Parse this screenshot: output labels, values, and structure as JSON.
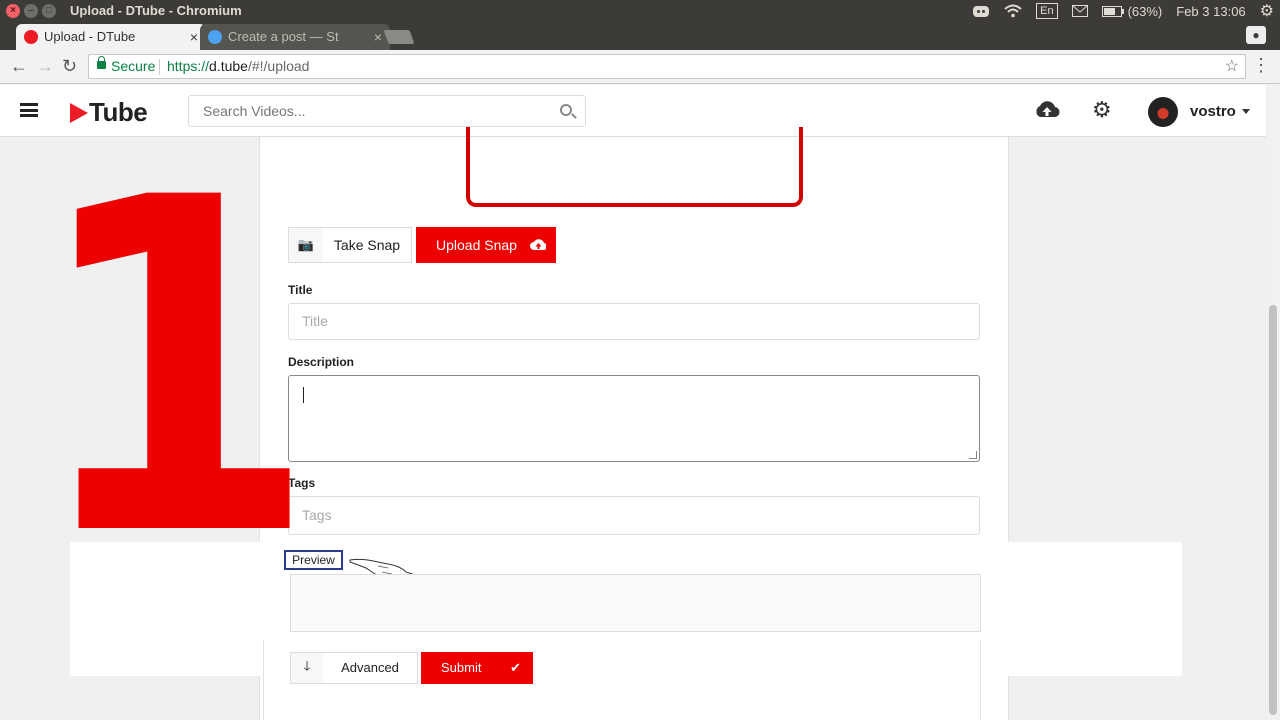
{
  "os": {
    "window_title": "Upload - DTube - Chromium",
    "battery": "(63%)",
    "datetime": "Feb 3 13:06",
    "lang": "En"
  },
  "tabs": [
    {
      "label": "Upload - DTube",
      "active": true
    },
    {
      "label": "Create a post — St",
      "active": false
    }
  ],
  "addressbar": {
    "secure_label": "Secure",
    "url_scheme": "https://",
    "url_host": "d.tube",
    "url_path": "/#!/upload"
  },
  "header": {
    "logo_text": "Tube",
    "search_placeholder": "Search Videos...",
    "username": "vostro"
  },
  "overlay": {
    "big_number": "1"
  },
  "form": {
    "take_snap_label": "Take Snap",
    "upload_snap_label": "Upload Snap",
    "title_label": "Title",
    "title_placeholder": "Title",
    "description_label": "Description",
    "tags_label": "Tags",
    "tags_placeholder": "Tags",
    "preview_label": "Preview",
    "advanced_label": "Advanced",
    "submit_label": "Submit"
  },
  "colors": {
    "brand_red": "#ee0000",
    "secure_green": "#0b8043"
  },
  "icons": [
    "camera-icon",
    "cloud-upload-icon",
    "search-icon",
    "gears-icon",
    "arrow-down-icon",
    "check-icon",
    "pointing-hand-icon"
  ]
}
